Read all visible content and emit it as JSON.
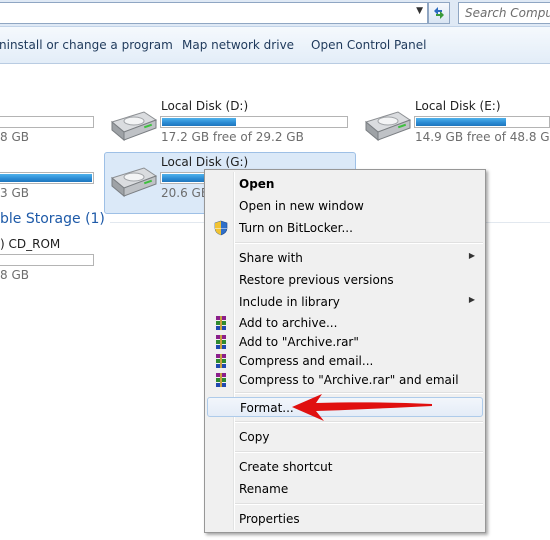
{
  "addressbar": {
    "search_placeholder": "Search Computer",
    "dropdown_glyph": "▼"
  },
  "commandbar": {
    "items": [
      "Uninstall or change a program",
      "Map network drive",
      "Open Control Panel"
    ],
    "uninstall_visible": "ninstall or change a program"
  },
  "drives": [
    {
      "name": "",
      "size": "8 GB",
      "fill_percent": 0
    },
    {
      "name": "Local Disk (D:)",
      "size": "17.2 GB free of 29.2 GB",
      "fill_percent": 41
    },
    {
      "name": "Local Disk (E:)",
      "size": "14.9 GB free of 48.8 GB",
      "fill_percent": 69
    },
    {
      "name": "",
      "size": "3 GB",
      "fill_percent": 100
    },
    {
      "name": "Local Disk (G:)",
      "size": "20.6 GB",
      "fill_percent": 30,
      "selected": true
    }
  ],
  "removable": {
    "heading": "ble Storage (1)",
    "item_name": ") CD_ROM",
    "item_size": "8 GB"
  },
  "context_menu": {
    "items": [
      {
        "label": "Open",
        "bold": true
      },
      {
        "label": "Open in new window"
      },
      {
        "label": "Turn on BitLocker...",
        "icon": "shield-icon"
      },
      {
        "label": "Share with",
        "submenu": true
      },
      {
        "label": "Restore previous versions"
      },
      {
        "label": "Include in library",
        "submenu": true
      },
      {
        "label": "Add to archive...",
        "icon": "winrar-icon"
      },
      {
        "label": "Add to \"Archive.rar\"",
        "icon": "winrar-icon"
      },
      {
        "label": "Compress and email...",
        "icon": "winrar-icon"
      },
      {
        "label": "Compress to \"Archive.rar\" and email",
        "icon": "winrar-icon"
      },
      {
        "label": "Format...",
        "highlighted": true
      },
      {
        "label": "Copy"
      },
      {
        "label": "Create shortcut"
      },
      {
        "label": "Rename"
      },
      {
        "label": "Properties"
      }
    ]
  },
  "colors": {
    "accent": "#1e5aa8",
    "bar_fill": "#2a8ad3",
    "annotation_arrow": "#e01010"
  }
}
